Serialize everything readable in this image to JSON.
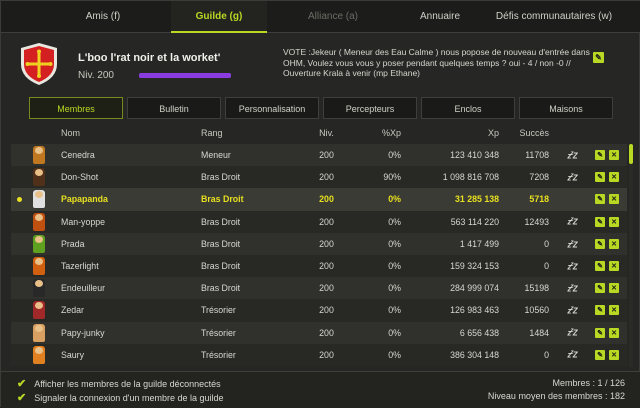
{
  "top_tabs": [
    {
      "label": "Amis (f)",
      "state": "normal"
    },
    {
      "label": "Guilde (g)",
      "state": "active"
    },
    {
      "label": "Alliance (a)",
      "state": "disabled"
    },
    {
      "label": "Annuaire",
      "state": "normal"
    },
    {
      "label": "Défis communautaires (w)",
      "state": "normal"
    }
  ],
  "guild": {
    "name": "L'boo l'rat noir et la worket'",
    "level": "Niv. 200",
    "xp_progress": 1.0,
    "emblem_colors": {
      "shield": "#d42020",
      "cross": "#f0d020"
    },
    "motd": "VOTE :Jekeur ( Meneur des Eau Calme ) nous popose de nouveau d'entrée dans OHM, Voulez vous vous y poser pendant quelques temps ? oui - 4 / non -0 // Ouverture Krala à venir (mp Ethane)"
  },
  "sub_tabs": [
    "Membres",
    "Bulletin",
    "Personnalisation",
    "Percepteurs",
    "Enclos",
    "Maisons"
  ],
  "active_sub_tab": "Membres",
  "table": {
    "headers": {
      "nom": "Nom",
      "rang": "Rang",
      "niv": "Niv.",
      "pxp": "%Xp",
      "xp": "Xp",
      "succes": "Succès"
    },
    "rows": [
      {
        "nom": "Cenedra",
        "rang": "Meneur",
        "niv": "200",
        "pxp": "0%",
        "xp": "123 410 348",
        "succes": "11708",
        "status": "zz",
        "actions": true,
        "avatar_color": "#c07820"
      },
      {
        "nom": "Don-Shot",
        "rang": "Bras Droit",
        "niv": "200",
        "pxp": "90%",
        "xp": "1 098 816 708",
        "succes": "7208",
        "status": "zz",
        "actions": true,
        "avatar_color": "#503018"
      },
      {
        "nom": "Papapanda",
        "rang": "Bras Droit",
        "niv": "200",
        "pxp": "0%",
        "xp": "31 285 138",
        "succes": "5718",
        "status": "",
        "actions": true,
        "avatar_color": "#e0e0e0",
        "self": true
      },
      {
        "nom": "Man-yoppe",
        "rang": "Bras Droit",
        "niv": "200",
        "pxp": "0%",
        "xp": "563 114 220",
        "succes": "12493",
        "status": "zz",
        "actions": true,
        "avatar_color": "#c05010"
      },
      {
        "nom": "Prada",
        "rang": "Bras Droit",
        "niv": "200",
        "pxp": "0%",
        "xp": "1 417 499",
        "succes": "0",
        "status": "zz",
        "actions": true,
        "avatar_color": "#60a020"
      },
      {
        "nom": "Tazerlight",
        "rang": "Bras Droit",
        "niv": "200",
        "pxp": "0%",
        "xp": "159 324 153",
        "succes": "0",
        "status": "zz",
        "actions": true,
        "avatar_color": "#d06010"
      },
      {
        "nom": "Endeuilleur",
        "rang": "Bras Droit",
        "niv": "200",
        "pxp": "0%",
        "xp": "284 999 074",
        "succes": "15198",
        "status": "zz",
        "actions": true,
        "avatar_color": "#282828"
      },
      {
        "nom": "Zedar",
        "rang": "Trésorier",
        "niv": "200",
        "pxp": "0%",
        "xp": "126 983 463",
        "succes": "10560",
        "status": "zz",
        "actions": true,
        "avatar_color": "#a02828"
      },
      {
        "nom": "Papy-junky",
        "rang": "Trésorier",
        "niv": "200",
        "pxp": "0%",
        "xp": "6 656 438",
        "succes": "1484",
        "status": "zz",
        "actions": true,
        "avatar_color": "#d8a060"
      },
      {
        "nom": "Saury",
        "rang": "Trésorier",
        "niv": "200",
        "pxp": "0%",
        "xp": "386 304 148",
        "succes": "0",
        "status": "zz",
        "actions": true,
        "avatar_color": "#e08020"
      }
    ]
  },
  "footer": {
    "check1": "Afficher les membres de la guilde déconnectés",
    "check2": "Signaler la connexion d'un membre de la guilde",
    "members": "Membres : 1 / 126",
    "avg_level": "Niveau moyen des membres : 182"
  },
  "icons": {
    "edit": "pencil-icon",
    "kick": "close-icon",
    "sleep": "zz-icon",
    "check": "checkmark-icon"
  },
  "colors": {
    "accent": "#b8d824",
    "self_highlight": "#e8e020",
    "xp_bar": "#8a3ce0"
  }
}
